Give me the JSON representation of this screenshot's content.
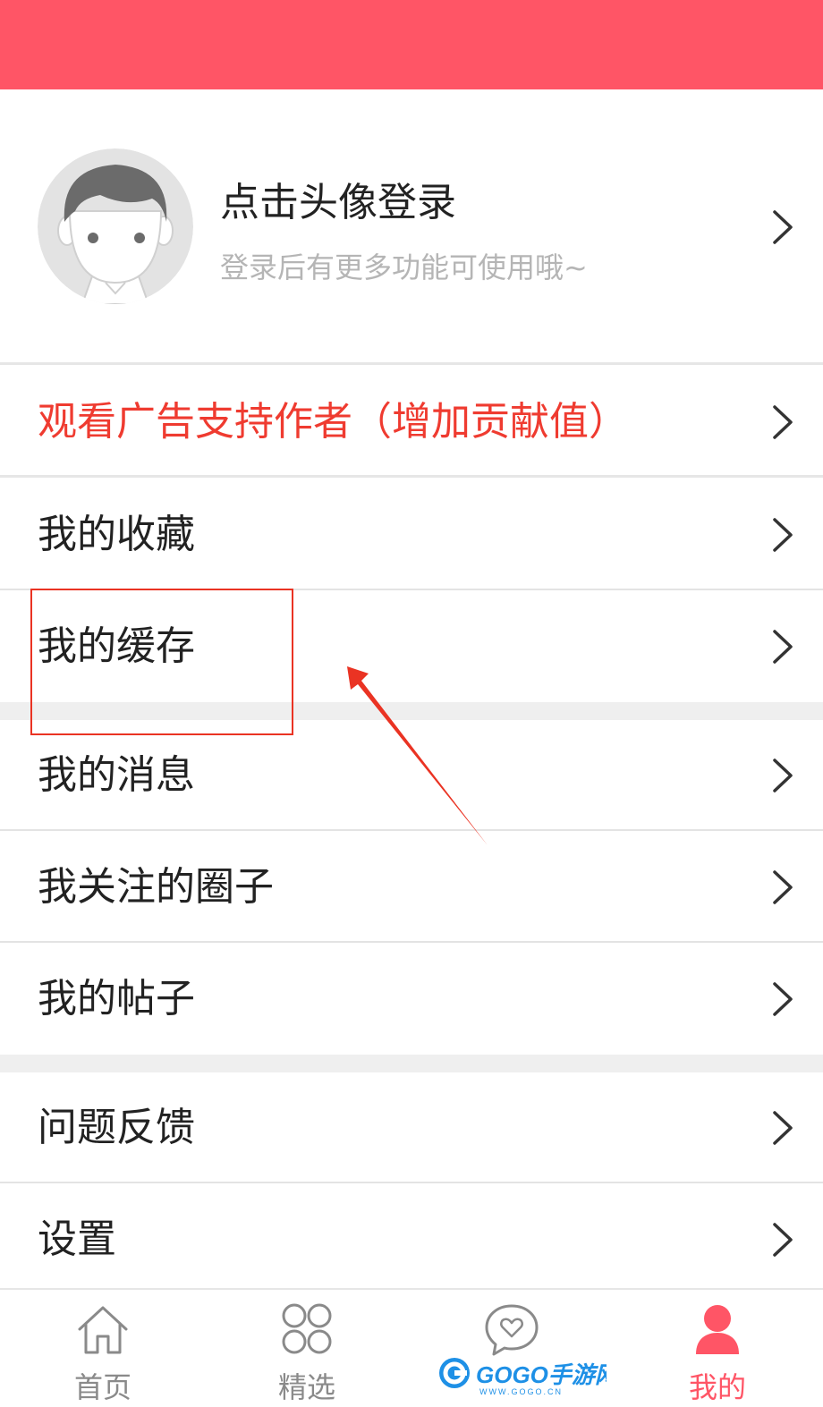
{
  "colors": {
    "accent": "#ff5566",
    "ad_text": "#ef3b30",
    "annotation": "#ea3323",
    "tab_inactive": "#8a8a8a",
    "divider": "#e3e3e3"
  },
  "header": {
    "icon": "none"
  },
  "profile": {
    "title": "点击头像登录",
    "subtitle": "登录后有更多功能可使用哦~",
    "avatar_icon": "default-avatar-icon",
    "chevron_icon": "chevron-right-icon"
  },
  "menu": {
    "ad_label": "观看广告支持作者（增加贡献值）",
    "items": [
      {
        "label": "我的收藏"
      },
      {
        "label": "我的缓存"
      },
      {
        "label": "我的消息"
      },
      {
        "label": "我关注的圈子"
      },
      {
        "label": "我的帖子"
      },
      {
        "label": "问题反馈"
      },
      {
        "label": "设置"
      }
    ]
  },
  "tabbar": {
    "tabs": [
      {
        "label": "首页",
        "icon": "home-icon",
        "active": false
      },
      {
        "label": "精选",
        "icon": "grid-icon",
        "active": false
      },
      {
        "label": "",
        "icon": "heart-bubble-icon",
        "active": false
      },
      {
        "label": "我的",
        "icon": "user-icon",
        "active": true
      }
    ]
  },
  "watermark": {
    "brand": "GOGO手游网",
    "url": "WWW.GOGO.CN"
  }
}
